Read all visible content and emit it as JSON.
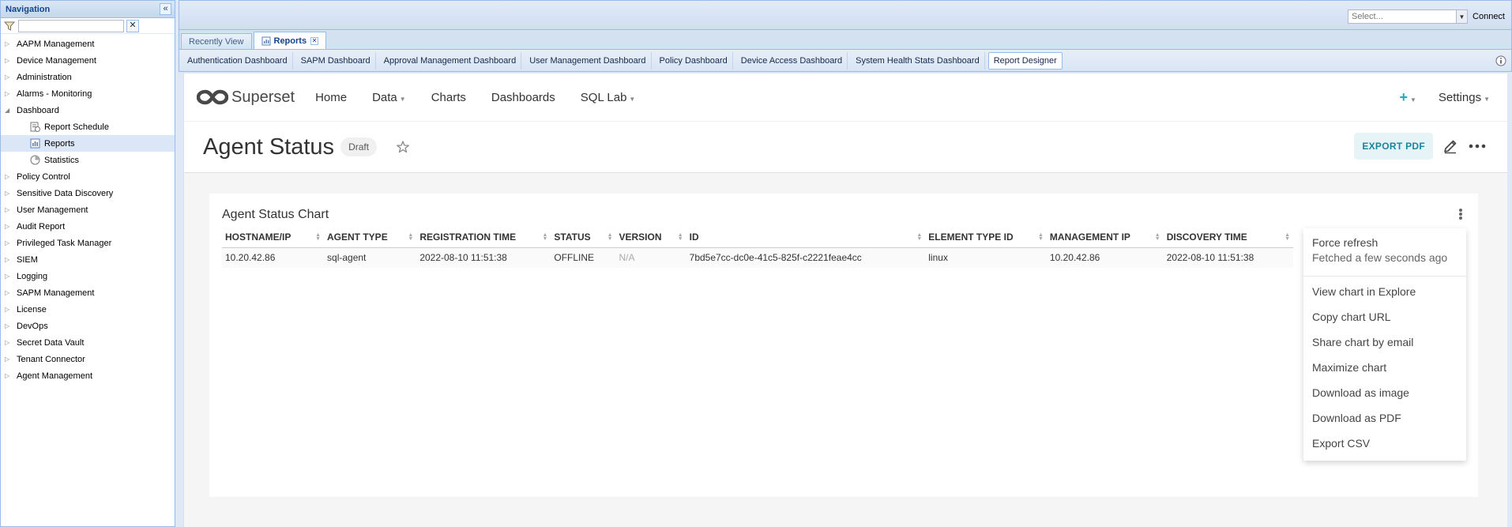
{
  "nav": {
    "title": "Navigation",
    "collapse_glyph": "«",
    "filter_value": "",
    "clear_glyph": "✕",
    "items": [
      {
        "label": "AAPM Management",
        "expanded": false
      },
      {
        "label": "Device Management",
        "expanded": false
      },
      {
        "label": "Administration",
        "expanded": false
      },
      {
        "label": "Alarms - Monitoring",
        "expanded": false
      },
      {
        "label": "Dashboard",
        "expanded": true
      },
      {
        "label": "Report Schedule",
        "child": true,
        "icon": "report-schedule-icon"
      },
      {
        "label": "Reports",
        "child": true,
        "icon": "reports-icon",
        "selected": true
      },
      {
        "label": "Statistics",
        "child": true,
        "icon": "statistics-icon"
      },
      {
        "label": "Policy Control",
        "expanded": false
      },
      {
        "label": "Sensitive Data Discovery",
        "expanded": false
      },
      {
        "label": "User Management",
        "expanded": false
      },
      {
        "label": "Audit Report",
        "expanded": false
      },
      {
        "label": "Privileged Task Manager",
        "expanded": false
      },
      {
        "label": "SIEM",
        "expanded": false
      },
      {
        "label": "Logging",
        "expanded": false
      },
      {
        "label": "SAPM Management",
        "expanded": false
      },
      {
        "label": "License",
        "expanded": false
      },
      {
        "label": "DevOps",
        "expanded": false
      },
      {
        "label": "Secret Data Vault",
        "expanded": false
      },
      {
        "label": "Tenant Connector",
        "expanded": false
      },
      {
        "label": "Agent Management",
        "expanded": false
      }
    ]
  },
  "topbar": {
    "select_placeholder": "Select...",
    "connect_label": "Connect"
  },
  "tabs": [
    {
      "label": "Recently View",
      "active": false
    },
    {
      "label": "Reports",
      "active": true,
      "close": "✕"
    }
  ],
  "subtabs": [
    {
      "label": "Authentication Dashboard",
      "active": false
    },
    {
      "label": "SAPM Dashboard",
      "active": false
    },
    {
      "label": "Approval Management Dashboard",
      "active": false
    },
    {
      "label": "User Management Dashboard",
      "active": false
    },
    {
      "label": "Policy Dashboard",
      "active": false
    },
    {
      "label": "Device Access Dashboard",
      "active": false
    },
    {
      "label": "System Health Stats Dashboard",
      "active": false
    },
    {
      "label": "Report Designer",
      "active": true
    }
  ],
  "superset": {
    "logo_text": "Superset",
    "menu": [
      {
        "label": "Home",
        "caret": false
      },
      {
        "label": "Data",
        "caret": true
      },
      {
        "label": "Charts",
        "caret": false
      },
      {
        "label": "Dashboards",
        "caret": false
      },
      {
        "label": "SQL Lab",
        "caret": true
      }
    ],
    "plus": "+",
    "settings": "Settings",
    "accent_color": "#20a7c9"
  },
  "dashboard": {
    "title": "Agent Status",
    "badge": "Draft",
    "export_label": "EXPORT PDF"
  },
  "chart": {
    "title": "Agent Status Chart",
    "columns": [
      "HOSTNAME/IP",
      "AGENT TYPE",
      "REGISTRATION TIME",
      "STATUS",
      "VERSION",
      "ID",
      "ELEMENT TYPE ID",
      "MANAGEMENT IP",
      "DISCOVERY TIME"
    ],
    "rows": [
      [
        "10.20.42.86",
        "sql-agent",
        "2022-08-10 11:51:38",
        "OFFLINE",
        "N/A",
        "7bd5e7cc-dc0e-41c5-825f-c2221feae4cc",
        "linux",
        "10.20.42.86",
        "2022-08-10 11:51:38"
      ]
    ]
  },
  "dropdown": {
    "force_refresh": "Force refresh",
    "fetched": "Fetched a few seconds ago",
    "items": [
      "View chart in Explore",
      "Copy chart URL",
      "Share chart by email",
      "Maximize chart",
      "Download as image",
      "Download as PDF",
      "Export CSV"
    ]
  }
}
